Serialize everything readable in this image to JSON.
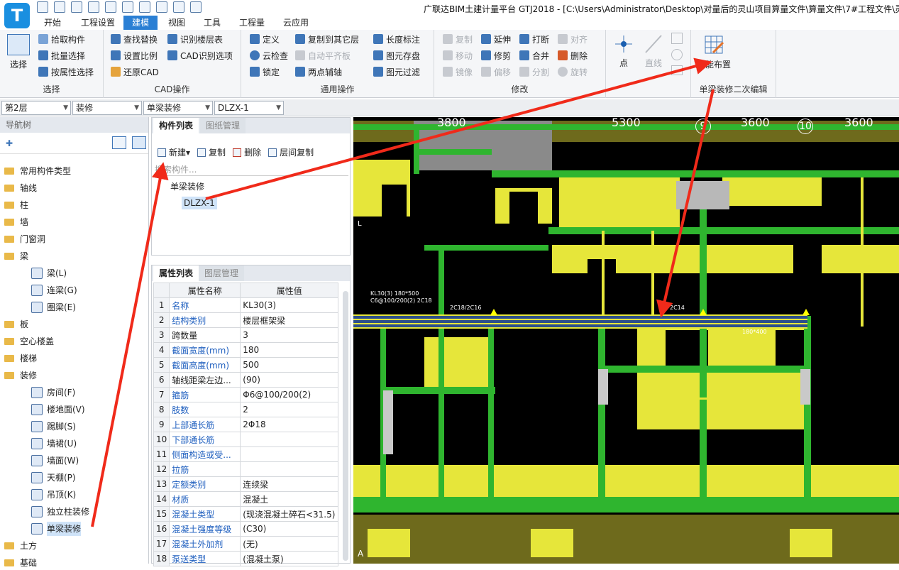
{
  "title": "广联达BIM土建计量平台 GTJ2018 - [C:\\Users\\Administrator\\Desktop\\对量后的灵山项目算量文件\\算量文件\\7#工程文件\\灵",
  "logo_letter": "T",
  "menu": [
    "开始",
    "工程设置",
    "建模",
    "视图",
    "工具",
    "工程量",
    "云应用"
  ],
  "ribbon": {
    "select_group": {
      "big": "选择",
      "items": [
        "拾取构件",
        "批量选择",
        "按属性选择"
      ],
      "label": "选择"
    },
    "cad_group": {
      "items": [
        "查找替换",
        "识别楼层表",
        "设置比例",
        "CAD识别选项",
        "还原CAD"
      ],
      "label": "CAD操作"
    },
    "general_group": {
      "items": [
        "定义",
        "复制到其它层",
        "长度标注",
        "云检查",
        "自动平齐板",
        "图元存盘",
        "锁定",
        "两点辅轴",
        "图元过滤"
      ],
      "label": "通用操作"
    },
    "modify_group": {
      "items": [
        "复制",
        "延伸",
        "打断",
        "对齐",
        "移动",
        "修剪",
        "合并",
        "删除",
        "镜像",
        "偏移",
        "分割",
        "旋转"
      ],
      "label": "修改"
    },
    "draw_group": {
      "point": "点",
      "line": "直线"
    },
    "smart_group": {
      "big": "智能布置",
      "label": "单梁装修二次编辑"
    }
  },
  "selectors": [
    "第2层",
    "装修",
    "单梁装修",
    "DLZX-1"
  ],
  "nav": {
    "title": "导航树",
    "items": [
      {
        "label": "常用构件类型",
        "type": "folder"
      },
      {
        "label": "轴线",
        "type": "folder"
      },
      {
        "label": "柱",
        "type": "folder"
      },
      {
        "label": "墙",
        "type": "folder"
      },
      {
        "label": "门窗洞",
        "type": "folder"
      },
      {
        "label": "梁",
        "type": "folder"
      },
      {
        "label": "梁(L)",
        "type": "leaf"
      },
      {
        "label": "连梁(G)",
        "type": "leaf"
      },
      {
        "label": "圈梁(E)",
        "type": "leaf"
      },
      {
        "label": "板",
        "type": "folder"
      },
      {
        "label": "空心楼盖",
        "type": "folder"
      },
      {
        "label": "楼梯",
        "type": "folder"
      },
      {
        "label": "装修",
        "type": "folder"
      },
      {
        "label": "房间(F)",
        "type": "leaf"
      },
      {
        "label": "楼地面(V)",
        "type": "leaf"
      },
      {
        "label": "踢脚(S)",
        "type": "leaf"
      },
      {
        "label": "墙裙(U)",
        "type": "leaf"
      },
      {
        "label": "墙面(W)",
        "type": "leaf"
      },
      {
        "label": "天棚(P)",
        "type": "leaf"
      },
      {
        "label": "吊顶(K)",
        "type": "leaf"
      },
      {
        "label": "独立柱装修",
        "type": "leaf"
      },
      {
        "label": "单梁装修",
        "type": "leaf",
        "selected": true
      },
      {
        "label": "土方",
        "type": "folder"
      },
      {
        "label": "基础",
        "type": "folder"
      }
    ]
  },
  "complist": {
    "tab_active": "构件列表",
    "tab_inactive": "图纸管理",
    "tools": [
      "新建",
      "复制",
      "删除",
      "层间复制"
    ],
    "search_placeholder": "搜索构件...",
    "root": "单梁装修",
    "leaf": "DLZX-1"
  },
  "props": {
    "tab_active": "属性列表",
    "tab_inactive": "图层管理",
    "col_name": "属性名称",
    "col_value": "属性值",
    "rows": [
      {
        "n": "1",
        "name": "名称",
        "value": "KL30(3)",
        "link": true
      },
      {
        "n": "2",
        "name": "结构类别",
        "value": "楼层框架梁",
        "link": true
      },
      {
        "n": "3",
        "name": "跨数量",
        "value": "3",
        "link": false
      },
      {
        "n": "4",
        "name": "截面宽度(mm)",
        "value": "180",
        "link": true
      },
      {
        "n": "5",
        "name": "截面高度(mm)",
        "value": "500",
        "link": true
      },
      {
        "n": "6",
        "name": "轴线距梁左边...",
        "value": "(90)",
        "link": false
      },
      {
        "n": "7",
        "name": "箍筋",
        "value": "Φ6@100/200(2)",
        "link": true
      },
      {
        "n": "8",
        "name": "肢数",
        "value": "2",
        "link": true
      },
      {
        "n": "9",
        "name": "上部通长筋",
        "value": "2Φ18",
        "link": true
      },
      {
        "n": "10",
        "name": "下部通长筋",
        "value": "",
        "link": true
      },
      {
        "n": "11",
        "name": "侧面构造或受...",
        "value": "",
        "link": true
      },
      {
        "n": "12",
        "name": "拉筋",
        "value": "",
        "link": true
      },
      {
        "n": "13",
        "name": "定额类别",
        "value": "连续梁",
        "link": true
      },
      {
        "n": "14",
        "name": "材质",
        "value": "混凝土",
        "link": true
      },
      {
        "n": "15",
        "name": "混凝土类型",
        "value": "(现浇混凝土碎石<31.5)",
        "link": true
      },
      {
        "n": "16",
        "name": "混凝土强度等级",
        "value": "(C30)",
        "link": true
      },
      {
        "n": "17",
        "name": "混凝土外加剂",
        "value": "(无)",
        "link": true
      },
      {
        "n": "18",
        "name": "泵送类型",
        "value": "(混凝土泵)",
        "link": true
      }
    ]
  },
  "canvas": {
    "dims": [
      "3800",
      "5300",
      "3600",
      "3600"
    ],
    "axis_numbers": [
      "9",
      "10"
    ],
    "beam_annot_1": "KL30(3) 180*500",
    "beam_annot_2": "C6@100/200(2) 2C18",
    "beam_annot_3": "2C18/2C16",
    "beam_annot_4": "2C14",
    "beam_annot_5": "180*400",
    "left_letter_top": "L",
    "left_letter_bottom": "A"
  },
  "colors": {
    "accent": "#2a7fd4",
    "green": "#2fb52f",
    "yellow": "#e6e63a",
    "olive": "#6e6a1c",
    "arrow": "#f02a1a"
  }
}
